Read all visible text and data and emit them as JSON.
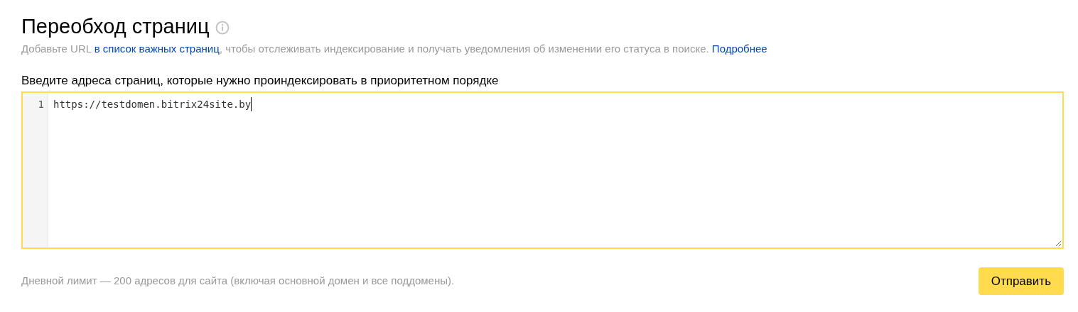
{
  "title": "Переобход страниц",
  "subtitle": [
    {
      "kind": "text",
      "text": "Добавьте URL "
    },
    {
      "kind": "link",
      "text": "в список важных страниц"
    },
    {
      "kind": "text",
      "text": ", чтобы отслеживать индексирование и получать уведомления об изменении его статуса в поиске. "
    },
    {
      "kind": "link",
      "text": "Подробнее"
    }
  ],
  "editor": {
    "label": "Введите адреса страниц, которые нужно проиндексировать в приоритетном порядке",
    "focused": true,
    "lines": [
      {
        "number": "1",
        "text": "https://testdomen.bitrix24site.by"
      }
    ]
  },
  "footer_note": "Дневной лимит — 200 адресов для сайта (включая основной домен и все поддомены).",
  "submit_button": "Отправить"
}
